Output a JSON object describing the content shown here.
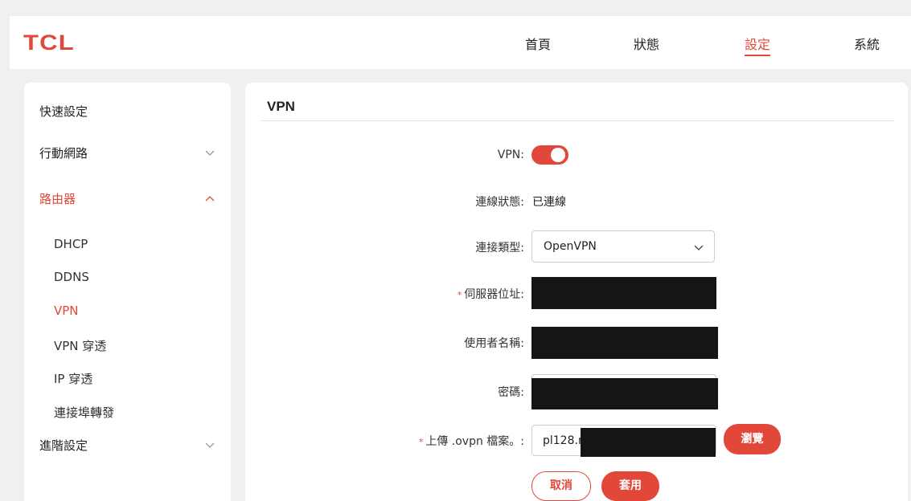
{
  "brand": {
    "logo": "TCL",
    "accent": "#e2483a"
  },
  "nav": {
    "items": [
      {
        "label": "首頁",
        "active": false
      },
      {
        "label": "狀態",
        "active": false
      },
      {
        "label": "設定",
        "active": true
      },
      {
        "label": "系統",
        "active": false
      }
    ]
  },
  "sidebar": {
    "items": [
      {
        "label": "快速設定"
      },
      {
        "label": "行動網路",
        "chevron": "chevron-down-icon"
      },
      {
        "label": "路由器",
        "chevron": "chevron-up-icon",
        "active": true
      },
      {
        "label": "進階設定",
        "chevron": "chevron-down-icon"
      }
    ],
    "subitems": [
      {
        "label": "DHCP"
      },
      {
        "label": "DDNS"
      },
      {
        "label": "VPN",
        "active": true
      },
      {
        "label": "VPN 穿透"
      },
      {
        "label": "IP 穿透"
      },
      {
        "label": "連接埠轉發"
      }
    ]
  },
  "main": {
    "title": "VPN",
    "form": {
      "vpn_label": "VPN:",
      "vpn_enabled": true,
      "status_label": "連線狀態:",
      "status_value": "已連線",
      "type_label": "連接類型:",
      "type_value": "OpenVPN",
      "server_label": "伺服器位址:",
      "server_required": "*",
      "username_label": "使用者名稱:",
      "password_label": "密碼:",
      "upload_label": "上傳 .ovpn 檔案。:",
      "upload_required": "*",
      "upload_value": "pl128.n",
      "browse_label": "瀏覽",
      "cancel_label": "取消",
      "apply_label": "套用"
    }
  }
}
